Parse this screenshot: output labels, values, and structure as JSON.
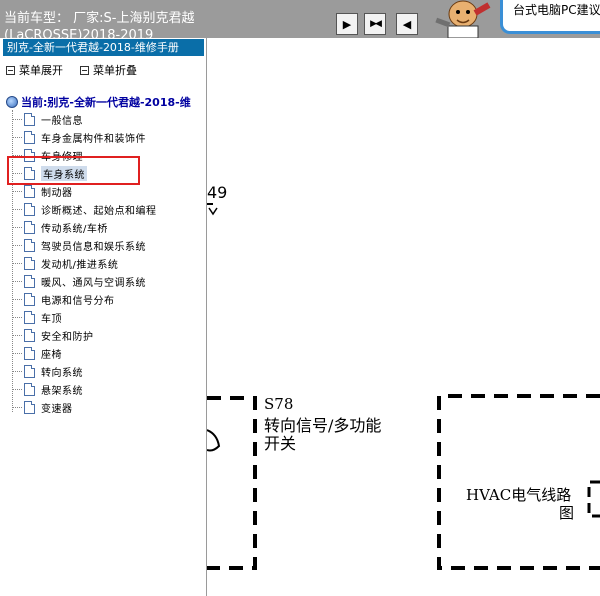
{
  "header": {
    "title_line1": "当前车型： 厂家:S-上海别克君越",
    "title_line2": "(LaCROSSE)2018-2019",
    "nav_buttons": [
      {
        "name": "nav-next-button",
        "glyph": "▶"
      },
      {
        "name": "nav-both-button",
        "glyph": "▶◀"
      },
      {
        "name": "nav-prev-button",
        "glyph": "◀"
      }
    ],
    "ad_text": "台式电脑PC建议"
  },
  "left_panel": {
    "title": "别克-全新一代君越-2018-维修手册",
    "expand_label": "菜单展开",
    "collapse_label": "菜单折叠",
    "current_label": "当前:别克-全新一代君越-2018-维",
    "items": [
      {
        "label": "一般信息"
      },
      {
        "label": "车身金属构件和装饰件"
      },
      {
        "label": "车身修理"
      },
      {
        "label": "车身系统",
        "selected": true
      },
      {
        "label": "制动器"
      },
      {
        "label": "诊断概述、起始点和编程"
      },
      {
        "label": "传动系统/车桥"
      },
      {
        "label": "驾驶员信息和娱乐系统"
      },
      {
        "label": "发动机/推进系统"
      },
      {
        "label": "暖风、通风与空调系统"
      },
      {
        "label": "电源和信号分布"
      },
      {
        "label": "车顶"
      },
      {
        "label": "安全和防护"
      },
      {
        "label": "座椅"
      },
      {
        "label": "转向系统"
      },
      {
        "label": "悬架系统"
      },
      {
        "label": "变速器"
      }
    ]
  },
  "diagram": {
    "fragment_number": "49",
    "s78_code": "S78",
    "s78_line1": "转向信号/多功能",
    "s78_line2": "开关",
    "hvac_line1": "HVAC电气线路",
    "hvac_line2": "图"
  },
  "colors": {
    "header_bg": "#9b9b9b",
    "panel_title_bg": "#0a6ea8",
    "highlight_border": "#e02020",
    "current_node_text": "#0000a0"
  }
}
